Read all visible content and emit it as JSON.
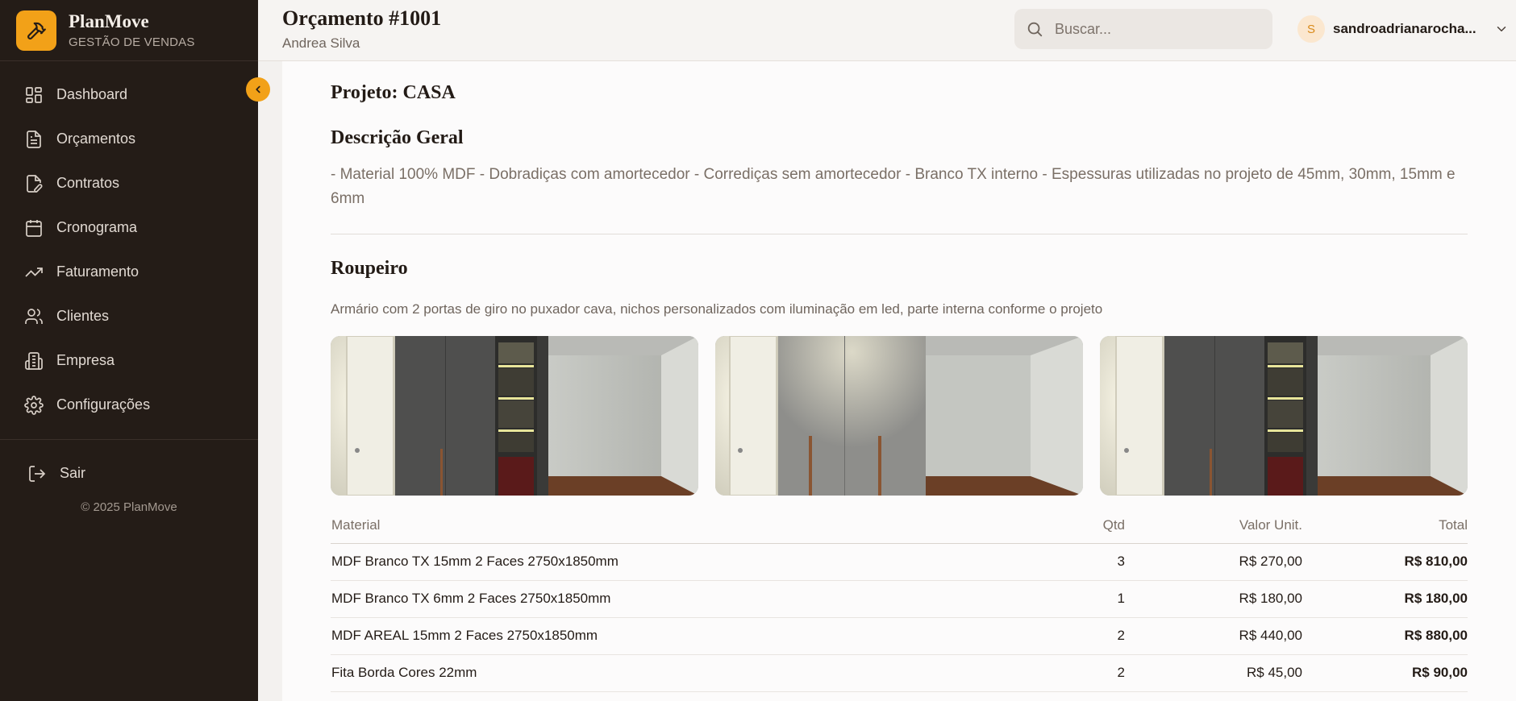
{
  "brand": {
    "name": "PlanMove",
    "subtitle": "GESTÃO DE VENDAS"
  },
  "sidebar": {
    "items": [
      {
        "label": "Dashboard",
        "icon": "dashboard-icon"
      },
      {
        "label": "Orçamentos",
        "icon": "document-icon"
      },
      {
        "label": "Contratos",
        "icon": "contract-edit-icon"
      },
      {
        "label": "Cronograma",
        "icon": "calendar-icon"
      },
      {
        "label": "Faturamento",
        "icon": "trending-up-icon"
      },
      {
        "label": "Clientes",
        "icon": "users-icon"
      },
      {
        "label": "Empresa",
        "icon": "building-icon"
      },
      {
        "label": "Configurações",
        "icon": "gear-icon"
      }
    ],
    "logout_label": "Sair",
    "copyright": "© 2025 PlanMove"
  },
  "header": {
    "title": "Orçamento #1001",
    "subtitle": "Andrea Silva",
    "search_placeholder": "Buscar...",
    "user_initial": "S",
    "user_name": "sandroadrianarocha..."
  },
  "main": {
    "project_title": "Projeto: CASA",
    "general_title": "Descrição Geral",
    "general_description": "- Material 100% MDF - Dobradiças com amortecedor - Corrediças sem amortecedor - Branco TX interno - Espessuras utilizadas no projeto de 45mm, 30mm, 15mm e 6mm",
    "item": {
      "title": "Roupeiro",
      "description": "Armário com 2 portas de giro no puxador cava, nichos personalizados com iluminação em led, parte interna conforme o projeto"
    },
    "table": {
      "headers": {
        "material": "Material",
        "qtd": "Qtd",
        "unit": "Valor Unit.",
        "total": "Total"
      },
      "rows": [
        {
          "material": "MDF Branco TX 15mm 2 Faces 2750x1850mm",
          "qtd": "3",
          "unit": "R$ 270,00",
          "total": "R$ 810,00"
        },
        {
          "material": "MDF Branco TX 6mm 2 Faces 2750x1850mm",
          "qtd": "1",
          "unit": "R$ 180,00",
          "total": "R$ 180,00"
        },
        {
          "material": "MDF AREAL 15mm 2 Faces 2750x1850mm",
          "qtd": "2",
          "unit": "R$ 440,00",
          "total": "R$ 880,00"
        },
        {
          "material": "Fita Borda Cores 22mm",
          "qtd": "2",
          "unit": "R$ 45,00",
          "total": "R$ 90,00"
        }
      ]
    }
  },
  "colors": {
    "accent": "#f2a118",
    "sidebar_bg": "#241c17",
    "header_bg": "#f6f4f2",
    "main_bg": "#fcfbfb"
  }
}
